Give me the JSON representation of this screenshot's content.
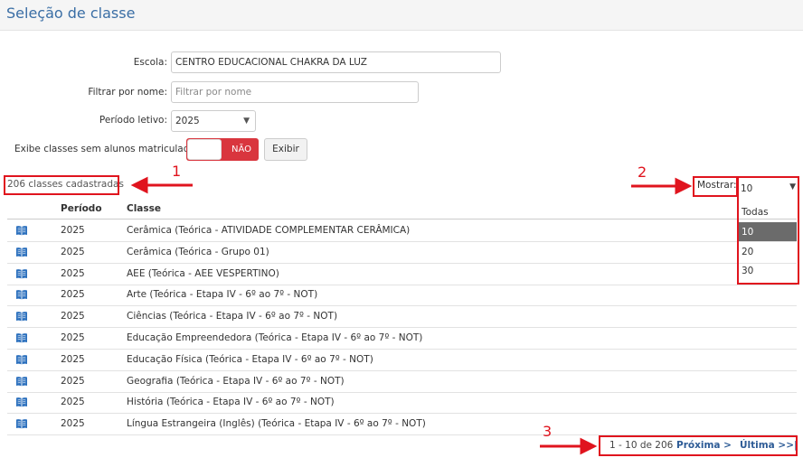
{
  "header": {
    "title": "Seleção de classe"
  },
  "form": {
    "escola_label": "Escola:",
    "escola_value": "CENTRO EDUCACIONAL CHAKRA DA LUZ",
    "filtrar_label": "Filtrar por nome:",
    "filtrar_placeholder": "Filtrar por nome",
    "periodo_label": "Período letivo:",
    "periodo_value": "2025",
    "exibe_label": "Exibe classes sem alunos matriculados:",
    "toggle_text": "NÃO",
    "exibir_label": "Exibir"
  },
  "summary": {
    "count_text": "206 classes cadastradas"
  },
  "mostrar": {
    "label": "Mostrar:",
    "value": "10",
    "options": [
      "Todas",
      "10",
      "20",
      "30"
    ],
    "selected_option": "10"
  },
  "table": {
    "headers": [
      "Período",
      "Classe"
    ],
    "rows": [
      {
        "periodo": "2025",
        "classe": "Cerâmica (Teórica - ATIVIDADE COMPLEMENTAR CERÂMICA)"
      },
      {
        "periodo": "2025",
        "classe": "Cerâmica (Teórica - Grupo 01)"
      },
      {
        "periodo": "2025",
        "classe": "AEE (Teórica - AEE VESPERTINO)"
      },
      {
        "periodo": "2025",
        "classe": "Arte (Teórica - Etapa IV - 6º ao 7º - NOT)"
      },
      {
        "periodo": "2025",
        "classe": "Ciências (Teórica - Etapa IV - 6º ao 7º - NOT)"
      },
      {
        "periodo": "2025",
        "classe": "Educação Empreendedora (Teórica - Etapa IV - 6º ao 7º - NOT)"
      },
      {
        "periodo": "2025",
        "classe": "Educação Física (Teórica - Etapa IV - 6º ao 7º - NOT)"
      },
      {
        "periodo": "2025",
        "classe": "Geografia (Teórica - Etapa IV - 6º ao 7º - NOT)"
      },
      {
        "periodo": "2025",
        "classe": "História (Teórica - Etapa IV - 6º ao 7º - NOT)"
      },
      {
        "periodo": "2025",
        "classe": "Língua Estrangeira (Inglês) (Teórica - Etapa IV - 6º ao 7º - NOT)"
      }
    ]
  },
  "pagination": {
    "range_text": "1 - 10 de 206",
    "next_label": "Próxima >",
    "last_label": "Última >>|"
  },
  "annotations": {
    "labels": [
      "1",
      "2",
      "3"
    ],
    "color": "#e0141e"
  },
  "colors": {
    "title": "#3a6ea5",
    "toggle": "#d9363e",
    "link": "#2d5b96",
    "book_icon": "#2a6fbd"
  }
}
